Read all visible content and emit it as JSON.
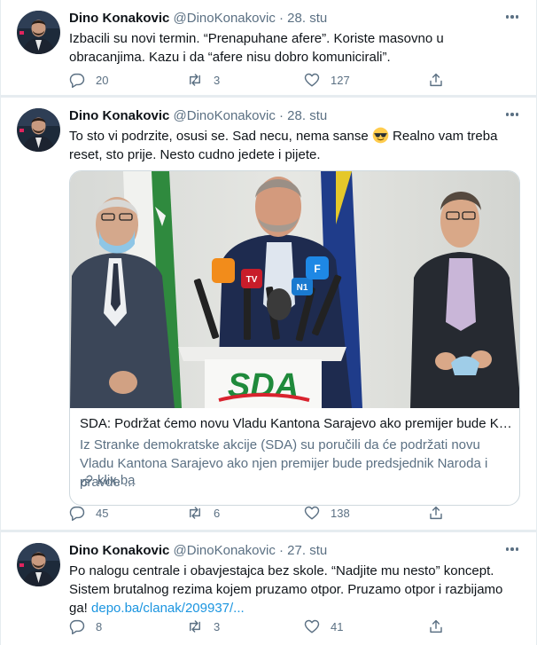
{
  "tweets": [
    {
      "name": "Dino Konakovic",
      "handle": "@DinoKonakovic",
      "separator": "·",
      "date": "28. stu",
      "text": "Izbacili su novi termin. “Prenapuhane afere”. Koriste masovno u obracanjima. Kazu i da “afere nisu dobro komunicirali”.",
      "replies": "20",
      "retweets": "3",
      "likes": "127"
    },
    {
      "name": "Dino Konakovic",
      "handle": "@DinoKonakovic",
      "separator": "·",
      "date": "28. stu",
      "text_before_emoji": "To sto vi podrzite, osusi se. Sad necu, nema sanse ",
      "text_after_emoji": " Realno vam treba reset, sto prije. Nesto cudno jedete i pijete.",
      "emoji_icon": "sunglasses-face-icon",
      "card": {
        "sign_text": "SDA",
        "title": "SDA: Podržat ćemo novu Vladu Kantona Sarajevo ako premijer bude Konaković",
        "description": "Iz Stranke demokratske akcije (SDA) su poručili da će podržati novu Vladu Kantona Sarajevo ako njen premijer bude predsjednik Naroda i pravde ...",
        "domain": "klix.ba",
        "mic_labels": [
          "TV",
          "N1",
          "F"
        ]
      },
      "replies": "45",
      "retweets": "6",
      "likes": "138"
    },
    {
      "name": "Dino Konakovic",
      "handle": "@DinoKonakovic",
      "separator": "·",
      "date": "27. stu",
      "text": "Po nalogu centrale i obavjestajca bez skole. “Nadjite mu nesto” koncept. Sistem brutalnog rezima kojem pruzamo otpor. Pruzamo otpor i razbijamo ga! ",
      "link": "depo.ba/clanak/209937/...",
      "replies": "8",
      "retweets": "3",
      "likes": "41"
    }
  ],
  "colors": {
    "text": "#0f1419",
    "secondary": "#5b7083",
    "link": "#1b95e0",
    "divider": "#e6ecf0",
    "border": "#cfd9de",
    "sda_green": "#1f8a3b",
    "sda_red": "#d9232e"
  }
}
